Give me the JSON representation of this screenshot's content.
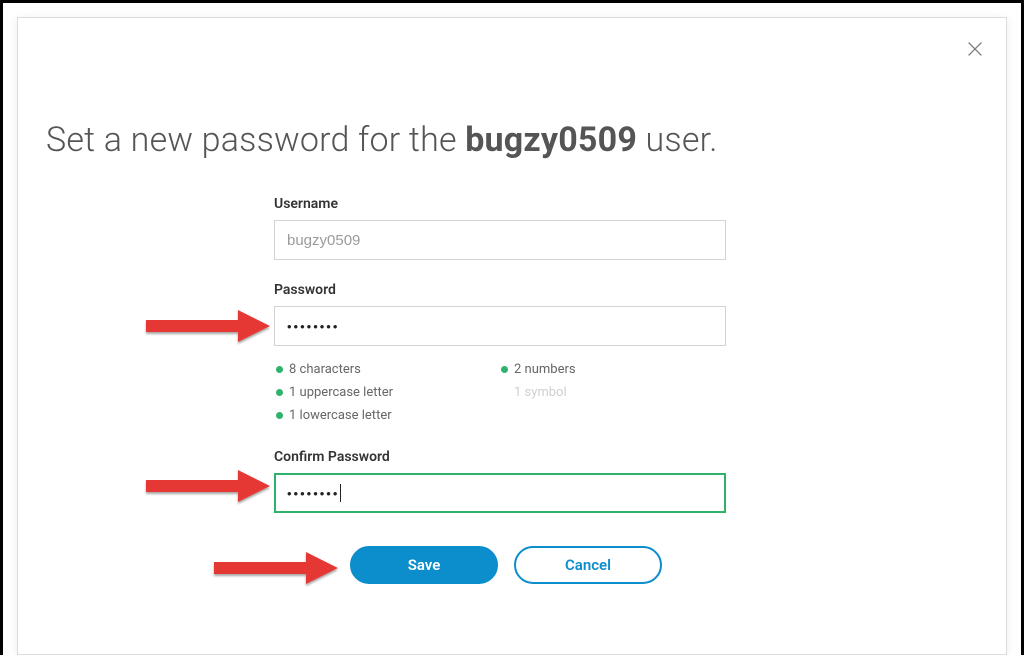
{
  "header": {
    "prefix": "Set a new password for the ",
    "username": "bugzy0509",
    "suffix": " user."
  },
  "fields": {
    "username": {
      "label": "Username",
      "value": "bugzy0509"
    },
    "password": {
      "label": "Password",
      "value": "••••••••"
    },
    "confirm": {
      "label": "Confirm Password",
      "value": "••••••••"
    }
  },
  "requirements": [
    {
      "label": "8 characters",
      "met": true
    },
    {
      "label": "2 numbers",
      "met": true
    },
    {
      "label": "1 uppercase letter",
      "met": true
    },
    {
      "label": "1 symbol",
      "met": false
    },
    {
      "label": "1 lowercase letter",
      "met": true
    }
  ],
  "buttons": {
    "save": "Save",
    "cancel": "Cancel"
  }
}
